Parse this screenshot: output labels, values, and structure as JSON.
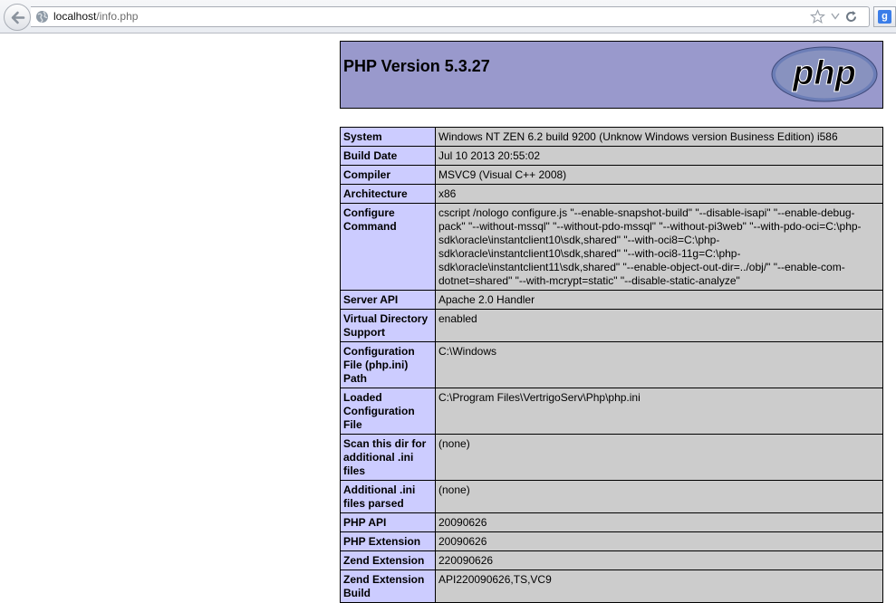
{
  "browser": {
    "url_host": "localhost",
    "url_path": "/info.php",
    "search_engine_badge": "g"
  },
  "header": {
    "title": "PHP Version 5.3.27",
    "logo_text": "php"
  },
  "rows": [
    {
      "label": "System",
      "value": "Windows NT ZEN 6.2 build 9200 (Unknow Windows version Business Edition) i586"
    },
    {
      "label": "Build Date",
      "value": "Jul 10 2013 20:55:02"
    },
    {
      "label": "Compiler",
      "value": "MSVC9 (Visual C++ 2008)"
    },
    {
      "label": "Architecture",
      "value": "x86"
    },
    {
      "label": "Configure Command",
      "value": "cscript /nologo configure.js \"--enable-snapshot-build\" \"--disable-isapi\" \"--enable-debug-pack\" \"--without-mssql\" \"--without-pdo-mssql\" \"--without-pi3web\" \"--with-pdo-oci=C:\\php-sdk\\oracle\\instantclient10\\sdk,shared\" \"--with-oci8=C:\\php-sdk\\oracle\\instantclient10\\sdk,shared\" \"--with-oci8-11g=C:\\php-sdk\\oracle\\instantclient11\\sdk,shared\" \"--enable-object-out-dir=../obj/\" \"--enable-com-dotnet=shared\" \"--with-mcrypt=static\" \"--disable-static-analyze\""
    },
    {
      "label": "Server API",
      "value": "Apache 2.0 Handler"
    },
    {
      "label": "Virtual Directory Support",
      "value": "enabled"
    },
    {
      "label": "Configuration File (php.ini) Path",
      "value": "C:\\Windows"
    },
    {
      "label": "Loaded Configuration File",
      "value": "C:\\Program Files\\VertrigoServ\\Php\\php.ini"
    },
    {
      "label": "Scan this dir for additional .ini files",
      "value": "(none)"
    },
    {
      "label": "Additional .ini files parsed",
      "value": "(none)"
    },
    {
      "label": "PHP API",
      "value": "20090626"
    },
    {
      "label": "PHP Extension",
      "value": "20090626"
    },
    {
      "label": "Zend Extension",
      "value": "220090626"
    },
    {
      "label": "Zend Extension Build",
      "value": "API220090626,TS,VC9"
    }
  ]
}
